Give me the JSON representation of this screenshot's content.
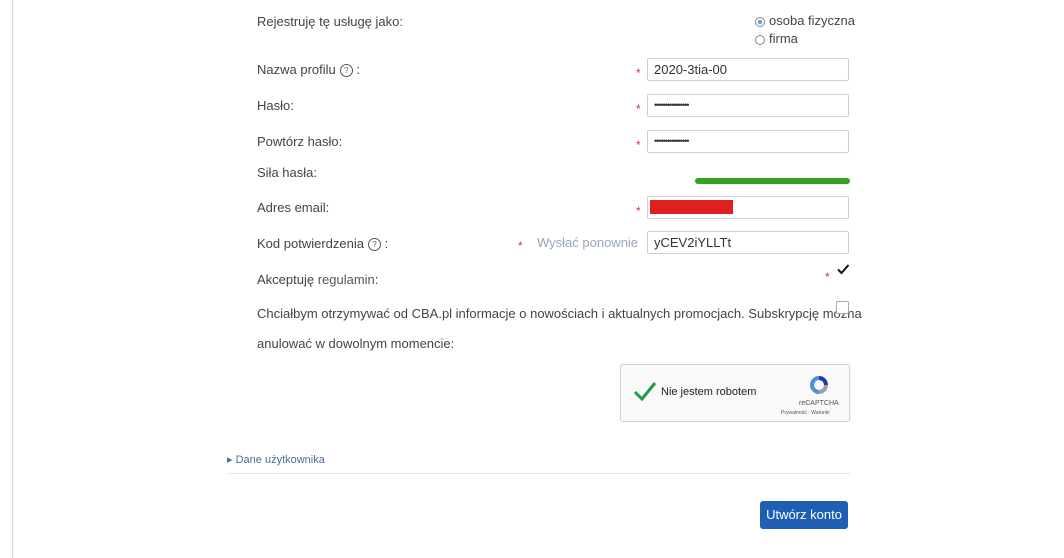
{
  "form": {
    "register_as_label": "Rejestruję tę usługę jako:",
    "register_options": [
      "osoba fizyczna",
      "firma"
    ],
    "register_selected": "osoba fizyczna",
    "profile_label": "Nazwa profilu",
    "profile_value": "2020-3tia-00",
    "password_label": "Hasło:",
    "password_value": "••••••••••••••••",
    "repeat_password_label": "Powtórz hasło:",
    "repeat_password_value": "••••••••••••••••",
    "strength_label": "Siła hasła:",
    "strength_level": 1.0,
    "strength_color": "#35a21b",
    "email_label": "Adres email:",
    "email_redaction_color": "#e02020",
    "code_label": "Kod potwierdzenia",
    "resend_label": "Wysłać ponownie",
    "code_value": "yCEV2iYLLTt",
    "terms_prefix": "Akceptuję ",
    "terms_link": "regulamin",
    "terms_suffix": ":",
    "terms_checked": true,
    "newsletter_line1": "Chciałbym otrzymywać od CBA.pl informacje o nowościach i aktualnych promocjach. Subskrypcję można",
    "newsletter_line2": "anulować w dowolnym momencie:",
    "newsletter_checked": false,
    "required_mark": "*",
    "help_glyph": "?",
    "colon": ":"
  },
  "captcha": {
    "label": "Nie jestem robotem",
    "brand": "reCAPTCHA",
    "links": "Prywatność - Warunki"
  },
  "user_data": {
    "label": "Dane użytkownika",
    "arrow": "▸"
  },
  "submit": {
    "label": "Utwórz konto"
  }
}
